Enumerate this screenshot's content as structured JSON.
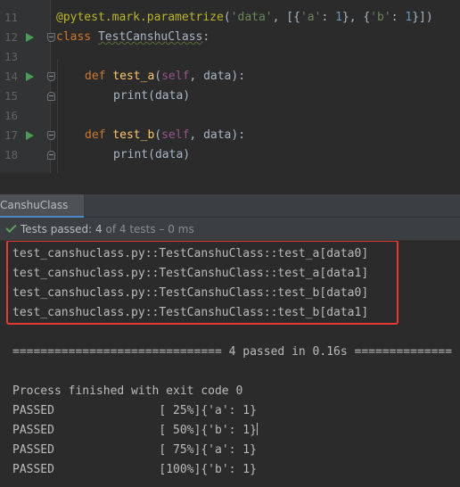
{
  "editor": {
    "lines": [
      {
        "num": "11"
      },
      {
        "num": "12"
      },
      {
        "num": "13"
      },
      {
        "num": "14"
      },
      {
        "num": "15"
      },
      {
        "num": "16"
      },
      {
        "num": "17"
      },
      {
        "num": "18"
      }
    ],
    "decorator": "@pytest.mark.parametrize",
    "param_name": "'data'",
    "dict_a_key": "'a'",
    "dict_a_val": "1",
    "dict_b_key": "'b'",
    "dict_b_val": "1",
    "class_kw": "class",
    "class_name": "TestCanshuClass",
    "def_kw": "def",
    "method_a": "test_a",
    "method_b": "test_b",
    "self_kw": "self",
    "arg": "data",
    "print_fn": "print"
  },
  "run_panel": {
    "tab_label": "CanshuClass",
    "status_label": "Tests passed:",
    "status_count": "4",
    "status_rest": "of 4 tests",
    "status_time": "– 0 ms"
  },
  "console": {
    "tests": [
      "test_canshuclass.py::TestCanshuClass::test_a[data0]",
      "test_canshuclass.py::TestCanshuClass::test_a[data1]",
      "test_canshuclass.py::TestCanshuClass::test_b[data0]",
      "test_canshuclass.py::TestCanshuClass::test_b[data1]"
    ],
    "summary": "============================== 4 passed in 0.16s ==============",
    "process_exit": "Process finished with exit code 0",
    "results": [
      {
        "status": "PASSED",
        "progress": "[ 25%]",
        "output": "{'a': 1}"
      },
      {
        "status": "PASSED",
        "progress": "[ 50%]",
        "output": "{'b': 1}"
      },
      {
        "status": "PASSED",
        "progress": "[ 75%]",
        "output": "{'a': 1}"
      },
      {
        "status": "PASSED",
        "progress": "[100%]",
        "output": "{'b': 1}"
      }
    ]
  },
  "colors": {
    "background": "#2b2b2b",
    "keyword": "#cc7832",
    "function": "#ffc66d",
    "string": "#6a8759",
    "number": "#6897bb",
    "decorator": "#bbb529",
    "highlight_box": "#e53935",
    "pass_green": "#499c54"
  }
}
